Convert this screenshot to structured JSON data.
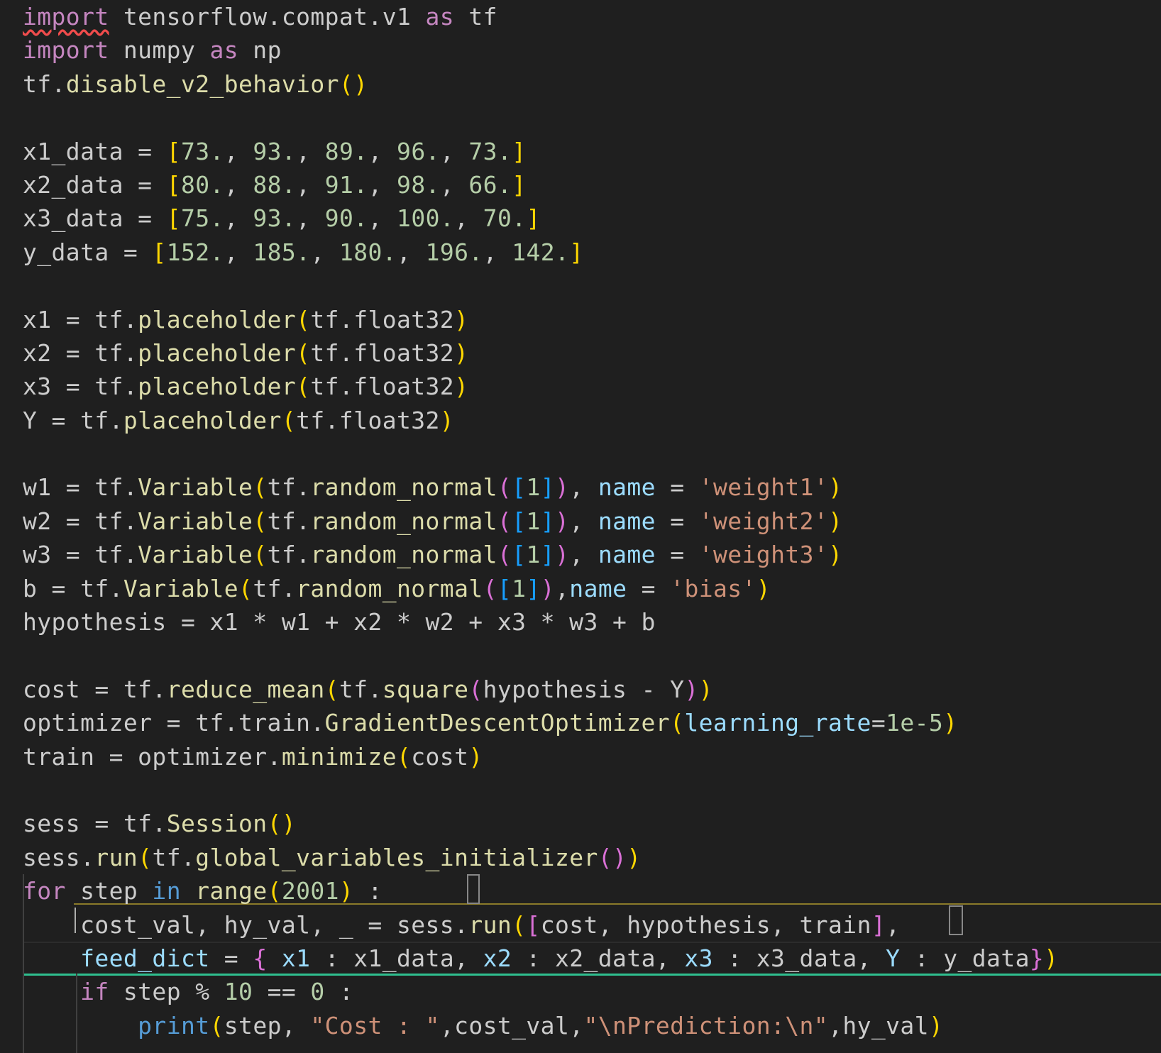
{
  "editor": {
    "language": "python",
    "lines": [
      [
        [
          "kw squiggle",
          "import"
        ],
        [
          "plain",
          " tensorflow.compat.v1 "
        ],
        [
          "kw",
          "as"
        ],
        [
          "plain",
          " tf"
        ]
      ],
      [
        [
          "kw",
          "import"
        ],
        [
          "plain",
          " numpy "
        ],
        [
          "kw",
          "as"
        ],
        [
          "plain",
          " np"
        ]
      ],
      [
        [
          "plain",
          "tf."
        ],
        [
          "fn",
          "disable_v2_behavior"
        ],
        [
          "p1",
          "()"
        ]
      ],
      [],
      [
        [
          "plain",
          "x1_data = "
        ],
        [
          "p1",
          "["
        ],
        [
          "num",
          "73."
        ],
        [
          "plain",
          ", "
        ],
        [
          "num",
          "93."
        ],
        [
          "plain",
          ", "
        ],
        [
          "num",
          "89."
        ],
        [
          "plain",
          ", "
        ],
        [
          "num",
          "96."
        ],
        [
          "plain",
          ", "
        ],
        [
          "num",
          "73."
        ],
        [
          "p1",
          "]"
        ]
      ],
      [
        [
          "plain",
          "x2_data = "
        ],
        [
          "p1",
          "["
        ],
        [
          "num",
          "80."
        ],
        [
          "plain",
          ", "
        ],
        [
          "num",
          "88."
        ],
        [
          "plain",
          ", "
        ],
        [
          "num",
          "91."
        ],
        [
          "plain",
          ", "
        ],
        [
          "num",
          "98."
        ],
        [
          "plain",
          ", "
        ],
        [
          "num",
          "66."
        ],
        [
          "p1",
          "]"
        ]
      ],
      [
        [
          "plain",
          "x3_data = "
        ],
        [
          "p1",
          "["
        ],
        [
          "num",
          "75."
        ],
        [
          "plain",
          ", "
        ],
        [
          "num",
          "93."
        ],
        [
          "plain",
          ", "
        ],
        [
          "num",
          "90."
        ],
        [
          "plain",
          ", "
        ],
        [
          "num",
          "100."
        ],
        [
          "plain",
          ", "
        ],
        [
          "num",
          "70."
        ],
        [
          "p1",
          "]"
        ]
      ],
      [
        [
          "plain",
          "y_data = "
        ],
        [
          "p1",
          "["
        ],
        [
          "num",
          "152."
        ],
        [
          "plain",
          ", "
        ],
        [
          "num",
          "185."
        ],
        [
          "plain",
          ", "
        ],
        [
          "num",
          "180."
        ],
        [
          "plain",
          ", "
        ],
        [
          "num",
          "196."
        ],
        [
          "plain",
          ", "
        ],
        [
          "num",
          "142."
        ],
        [
          "p1",
          "]"
        ]
      ],
      [],
      [
        [
          "plain",
          "x1 = tf."
        ],
        [
          "fn",
          "placeholder"
        ],
        [
          "p1",
          "("
        ],
        [
          "plain",
          "tf.float32"
        ],
        [
          "p1",
          ")"
        ]
      ],
      [
        [
          "plain",
          "x2 = tf."
        ],
        [
          "fn",
          "placeholder"
        ],
        [
          "p1",
          "("
        ],
        [
          "plain",
          "tf.float32"
        ],
        [
          "p1",
          ")"
        ]
      ],
      [
        [
          "plain",
          "x3 = tf."
        ],
        [
          "fn",
          "placeholder"
        ],
        [
          "p1",
          "("
        ],
        [
          "plain",
          "tf.float32"
        ],
        [
          "p1",
          ")"
        ]
      ],
      [
        [
          "plain",
          "Y = tf."
        ],
        [
          "fn",
          "placeholder"
        ],
        [
          "p1",
          "("
        ],
        [
          "plain",
          "tf.float32"
        ],
        [
          "p1",
          ")"
        ]
      ],
      [],
      [
        [
          "plain",
          "w1 = tf."
        ],
        [
          "fn",
          "Variable"
        ],
        [
          "p1",
          "("
        ],
        [
          "plain",
          "tf."
        ],
        [
          "fn",
          "random_normal"
        ],
        [
          "p2",
          "("
        ],
        [
          "p3",
          "["
        ],
        [
          "num",
          "1"
        ],
        [
          "p3",
          "]"
        ],
        [
          "p2",
          ")"
        ],
        [
          "plain",
          ", "
        ],
        [
          "param",
          "name"
        ],
        [
          "plain",
          " = "
        ],
        [
          "str",
          "'weight1'"
        ],
        [
          "p1",
          ")"
        ]
      ],
      [
        [
          "plain",
          "w2 = tf."
        ],
        [
          "fn",
          "Variable"
        ],
        [
          "p1",
          "("
        ],
        [
          "plain",
          "tf."
        ],
        [
          "fn",
          "random_normal"
        ],
        [
          "p2",
          "("
        ],
        [
          "p3",
          "["
        ],
        [
          "num",
          "1"
        ],
        [
          "p3",
          "]"
        ],
        [
          "p2",
          ")"
        ],
        [
          "plain",
          ", "
        ],
        [
          "param",
          "name"
        ],
        [
          "plain",
          " = "
        ],
        [
          "str",
          "'weight2'"
        ],
        [
          "p1",
          ")"
        ]
      ],
      [
        [
          "plain",
          "w3 = tf."
        ],
        [
          "fn",
          "Variable"
        ],
        [
          "p1",
          "("
        ],
        [
          "plain",
          "tf."
        ],
        [
          "fn",
          "random_normal"
        ],
        [
          "p2",
          "("
        ],
        [
          "p3",
          "["
        ],
        [
          "num",
          "1"
        ],
        [
          "p3",
          "]"
        ],
        [
          "p2",
          ")"
        ],
        [
          "plain",
          ", "
        ],
        [
          "param",
          "name"
        ],
        [
          "plain",
          " = "
        ],
        [
          "str",
          "'weight3'"
        ],
        [
          "p1",
          ")"
        ]
      ],
      [
        [
          "plain",
          "b = tf."
        ],
        [
          "fn",
          "Variable"
        ],
        [
          "p1",
          "("
        ],
        [
          "plain",
          "tf."
        ],
        [
          "fn",
          "random_normal"
        ],
        [
          "p2",
          "("
        ],
        [
          "p3",
          "["
        ],
        [
          "num",
          "1"
        ],
        [
          "p3",
          "]"
        ],
        [
          "p2",
          ")"
        ],
        [
          "plain",
          ","
        ],
        [
          "param",
          "name"
        ],
        [
          "plain",
          " = "
        ],
        [
          "str",
          "'bias'"
        ],
        [
          "p1",
          ")"
        ]
      ],
      [
        [
          "plain",
          "hypothesis = x1 * w1 + x2 * w2 + x3 * w3 + b"
        ]
      ],
      [],
      [
        [
          "plain",
          "cost = tf."
        ],
        [
          "fn",
          "reduce_mean"
        ],
        [
          "p1",
          "("
        ],
        [
          "plain",
          "tf."
        ],
        [
          "fn",
          "square"
        ],
        [
          "p2",
          "("
        ],
        [
          "plain",
          "hypothesis - Y"
        ],
        [
          "p2",
          ")"
        ],
        [
          "p1",
          ")"
        ]
      ],
      [
        [
          "plain",
          "optimizer = tf.train."
        ],
        [
          "fn",
          "GradientDescentOptimizer"
        ],
        [
          "p1",
          "("
        ],
        [
          "param",
          "learning_rate"
        ],
        [
          "plain",
          "="
        ],
        [
          "num",
          "1e-5"
        ],
        [
          "p1",
          ")"
        ]
      ],
      [
        [
          "plain",
          "train = optimizer."
        ],
        [
          "fn",
          "minimize"
        ],
        [
          "p1",
          "("
        ],
        [
          "plain",
          "cost"
        ],
        [
          "p1",
          ")"
        ]
      ],
      [],
      [
        [
          "plain",
          "sess = tf."
        ],
        [
          "fn",
          "Session"
        ],
        [
          "p1",
          "()"
        ]
      ],
      [
        [
          "plain",
          "sess."
        ],
        [
          "fn",
          "run"
        ],
        [
          "p1",
          "("
        ],
        [
          "plain",
          "tf."
        ],
        [
          "fn",
          "global_variables_initializer"
        ],
        [
          "p2",
          "()"
        ],
        [
          "p1",
          ")"
        ]
      ],
      [
        [
          "kw",
          "for"
        ],
        [
          "plain",
          " step "
        ],
        [
          "kw2",
          "in"
        ],
        [
          "plain",
          " "
        ],
        [
          "fn",
          "range"
        ],
        [
          "p1",
          "("
        ],
        [
          "num",
          "2001"
        ],
        [
          "p1",
          ")"
        ],
        [
          "plain",
          " :"
        ]
      ],
      [
        [
          "plain",
          "    cost_val, hy_val, _ = sess."
        ],
        [
          "fn",
          "run"
        ],
        [
          "p1",
          "("
        ],
        [
          "p2",
          "["
        ],
        [
          "plain",
          "cost, hypothesis, train"
        ],
        [
          "p2",
          "]"
        ],
        [
          "plain",
          ","
        ]
      ],
      [
        [
          "plain",
          "    "
        ],
        [
          "param",
          "feed_dict"
        ],
        [
          "plain",
          " = "
        ],
        [
          "p2",
          "{"
        ],
        [
          "plain",
          " "
        ],
        [
          "var",
          "x1"
        ],
        [
          "plain",
          " : x1_data, "
        ],
        [
          "var",
          "x2"
        ],
        [
          "plain",
          " : x2_data, "
        ],
        [
          "var",
          "x3"
        ],
        [
          "plain",
          " : x3_data, "
        ],
        [
          "var",
          "Y"
        ],
        [
          "plain",
          " : y_data"
        ],
        [
          "p2",
          "}"
        ],
        [
          "p1",
          ")"
        ]
      ],
      [
        [
          "plain",
          "    "
        ],
        [
          "kw",
          "if"
        ],
        [
          "plain",
          " step % "
        ],
        [
          "num",
          "10"
        ],
        [
          "plain",
          " == "
        ],
        [
          "num",
          "0"
        ],
        [
          "plain",
          " :"
        ]
      ],
      [
        [
          "plain",
          "        "
        ],
        [
          "kw2",
          "print"
        ],
        [
          "p1",
          "("
        ],
        [
          "plain",
          "step, "
        ],
        [
          "str",
          "\"Cost : \""
        ],
        [
          "plain",
          ",cost_val,"
        ],
        [
          "str",
          "\"\\nPrediction:\\n\""
        ],
        [
          "plain",
          ",hy_val"
        ],
        [
          "p1",
          ")"
        ]
      ]
    ]
  }
}
